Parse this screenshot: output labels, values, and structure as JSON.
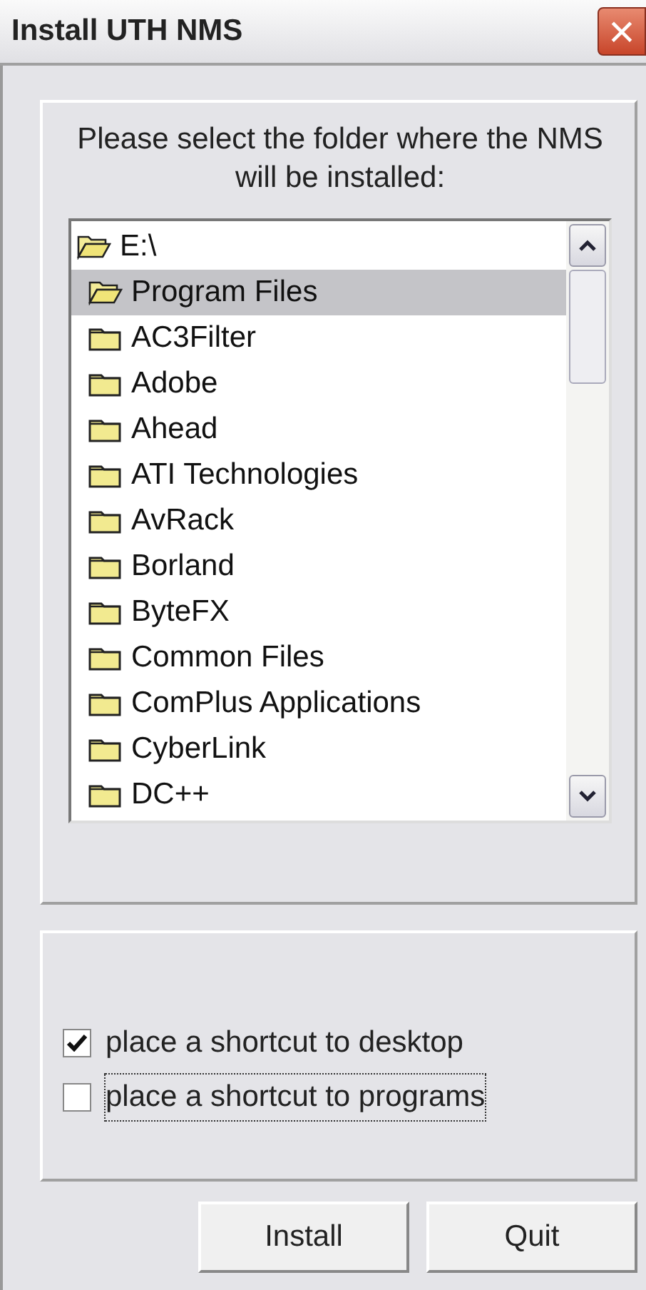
{
  "window": {
    "title": "Install UTH NMS",
    "close": "×"
  },
  "prompt": "Please select the folder where the NMS will be installed:",
  "folder_tree": [
    {
      "label": "E:\\",
      "expanded": true,
      "selected": false,
      "children": [
        {
          "label": "Program Files",
          "expanded": true,
          "selected": true,
          "children": [
            {
              "label": "AC3Filter",
              "expanded": false,
              "selected": false
            },
            {
              "label": "Adobe",
              "expanded": false,
              "selected": false
            },
            {
              "label": "Ahead",
              "expanded": false,
              "selected": false
            },
            {
              "label": "ATI Technologies",
              "expanded": false,
              "selected": false
            },
            {
              "label": "AvRack",
              "expanded": false,
              "selected": false
            },
            {
              "label": "Borland",
              "expanded": false,
              "selected": false
            },
            {
              "label": "ByteFX",
              "expanded": false,
              "selected": false
            },
            {
              "label": "Common Files",
              "expanded": false,
              "selected": false
            },
            {
              "label": "ComPlus Applications",
              "expanded": false,
              "selected": false
            },
            {
              "label": "CyberLink",
              "expanded": false,
              "selected": false
            },
            {
              "label": "DC++",
              "expanded": false,
              "selected": false
            }
          ]
        }
      ]
    }
  ],
  "options": [
    {
      "label": "place a shortcut to desktop",
      "checked": true,
      "focused": false
    },
    {
      "label": "place a shortcut to programs",
      "checked": false,
      "focused": true
    }
  ],
  "buttons": [
    "Install",
    "Quit"
  ]
}
